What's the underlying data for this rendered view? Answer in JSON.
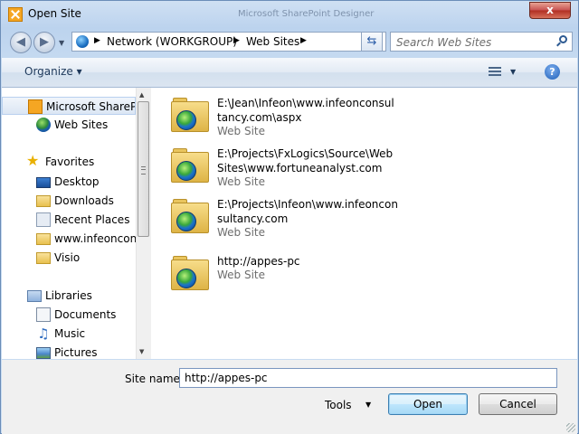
{
  "window": {
    "title": "Open Site",
    "background_title": "Microsoft SharePoint Designer",
    "close_label": "x"
  },
  "address_bar": {
    "crumbs": [
      "Network (WORKGROUP)",
      "Web Sites"
    ],
    "search_placeholder": "Search Web Sites"
  },
  "toolbar": {
    "organize_label": "Organize"
  },
  "nav_pane": {
    "items": [
      {
        "label": "Microsoft SharePoint",
        "icon": "sharepoint-icon",
        "selected": true
      },
      {
        "label": "Web Sites",
        "icon": "globe-icon"
      },
      {
        "label": "Favorites",
        "icon": "star-icon"
      },
      {
        "label": "Desktop",
        "icon": "desktop-icon"
      },
      {
        "label": "Downloads",
        "icon": "downloads-icon"
      },
      {
        "label": "Recent Places",
        "icon": "recent-places-icon"
      },
      {
        "label": "www.infeoncons",
        "icon": "folder-icon"
      },
      {
        "label": "Visio",
        "icon": "folder-icon"
      },
      {
        "label": "Libraries",
        "icon": "libraries-icon"
      },
      {
        "label": "Documents",
        "icon": "documents-icon"
      },
      {
        "label": "Music",
        "icon": "music-icon"
      },
      {
        "label": "Pictures",
        "icon": "pictures-icon"
      }
    ]
  },
  "sites": [
    {
      "path": "E:\\Jean\\Infeon\\www.infeonconsultancy.com\\aspx",
      "type": "Web Site"
    },
    {
      "path": "E:\\Projects\\FxLogics\\Source\\WebSites\\www.fortuneanalyst.com",
      "type": "Web Site"
    },
    {
      "path": "E:\\Projects\\Infeon\\www.infeonconsultancy.com",
      "type": "Web Site"
    },
    {
      "path": "http://appes-pc",
      "type": "Web Site"
    }
  ],
  "footer": {
    "site_name_label": "Site name:",
    "site_name_value": "http://appes-pc",
    "tools_label": "Tools",
    "open_label": "Open",
    "cancel_label": "Cancel"
  },
  "colors": {
    "frame": "#c4d9f0",
    "selection": "#dbe6f4",
    "close": "#c75050"
  }
}
